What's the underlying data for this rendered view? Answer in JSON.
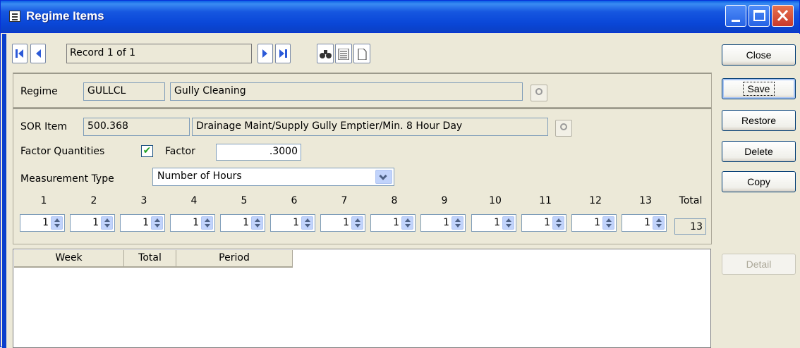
{
  "window": {
    "title": "Regime Items"
  },
  "nav": {
    "record": "Record 1 of 1"
  },
  "regime": {
    "label": "Regime",
    "code": "GULLCL",
    "description": "Gully Cleaning"
  },
  "sor": {
    "label": "SOR Item",
    "code": "500.368",
    "description": "Drainage Maint/Supply Gully Emptier/Min. 8 Hour Day"
  },
  "factor": {
    "qty_label": "Factor Quantities",
    "checked": true,
    "label": "Factor",
    "value": ".3000"
  },
  "measurement": {
    "label": "Measurement Type",
    "value": "Number of Hours"
  },
  "periods": {
    "headers": [
      "1",
      "2",
      "3",
      "4",
      "5",
      "6",
      "7",
      "8",
      "9",
      "10",
      "11",
      "12",
      "13"
    ],
    "values": [
      "1",
      "1",
      "1",
      "1",
      "1",
      "1",
      "1",
      "1",
      "1",
      "1",
      "1",
      "1",
      "1"
    ],
    "total_label": "Total",
    "total": "13"
  },
  "grid": {
    "columns": [
      "Week",
      "Total",
      "Period"
    ]
  },
  "buttons": {
    "close": "Close",
    "save": "Save",
    "restore": "Restore",
    "delete": "Delete",
    "copy": "Copy",
    "detail": "Detail"
  }
}
